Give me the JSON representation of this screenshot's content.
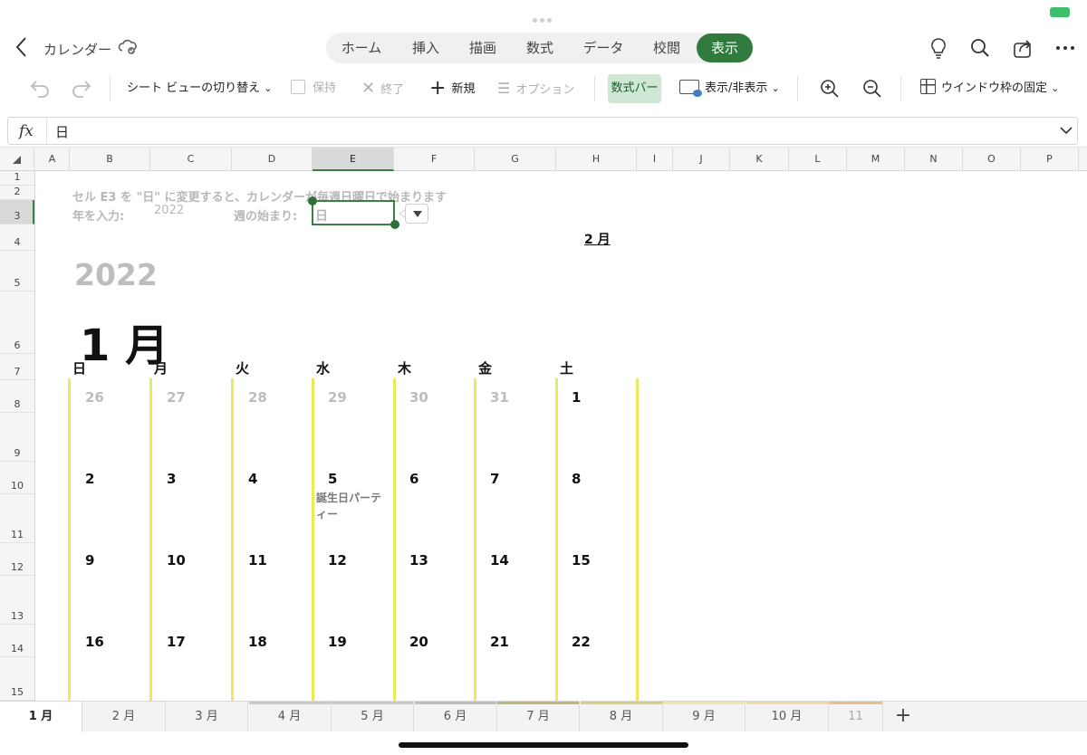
{
  "window": {
    "title": "カレンダー"
  },
  "ribbon": {
    "tabs": [
      "ホーム",
      "挿入",
      "描画",
      "数式",
      "データ",
      "校閲",
      "表示"
    ],
    "active": "表示"
  },
  "toolbar": {
    "sheet_view_label": "シート ビューの切り替え",
    "keep_label": "保持",
    "exit_label": "終了",
    "new_label": "新規",
    "options_label": "オプション",
    "formula_bar_label": "数式バー",
    "show_hide_label": "表示/非表示",
    "freeze_label": "ウインドウ枠の固定"
  },
  "formula_bar": {
    "fx": "fx",
    "value": "日"
  },
  "columns": [
    "A",
    "B",
    "C",
    "D",
    "E",
    "F",
    "G",
    "H",
    "I",
    "J",
    "K",
    "L",
    "M",
    "N",
    "O",
    "P"
  ],
  "selected_column": "E",
  "rows": [
    "1",
    "2",
    "3",
    "4",
    "5",
    "6",
    "7",
    "8",
    "9",
    "10",
    "11",
    "12",
    "13",
    "14",
    "15"
  ],
  "selected_row": "3",
  "sheet": {
    "hint": "セル E3 を \"日\" に変更すると、カレンダーが毎週日曜日で始まります",
    "year_label": "年を入力:",
    "year_value": "2022",
    "week_start_label": "週の始まり:",
    "week_start_value": "日",
    "next_month_link": "2 月",
    "year": "2022",
    "month": "1 月",
    "weekdays": [
      "日",
      "月",
      "火",
      "水",
      "木",
      "金",
      "土"
    ],
    "weeks": [
      [
        "26",
        "27",
        "28",
        "29",
        "30",
        "31",
        "1"
      ],
      [
        "2",
        "3",
        "4",
        "5",
        "6",
        "7",
        "8"
      ],
      [
        "9",
        "10",
        "11",
        "12",
        "13",
        "14",
        "15"
      ],
      [
        "16",
        "17",
        "18",
        "19",
        "20",
        "21",
        "22"
      ]
    ],
    "prev_month_days": 6,
    "event_note": "誕生日パーティー"
  },
  "sheet_tabs": [
    "1 月",
    "2 月",
    "3 月",
    "4 月",
    "5 月",
    "6 月",
    "7 月",
    "8 月",
    "9 月",
    "10 月",
    "11"
  ],
  "active_sheet": "1 月",
  "colors": {
    "accent": "#2f7a3c",
    "calendar_line": "#ecea5a"
  }
}
